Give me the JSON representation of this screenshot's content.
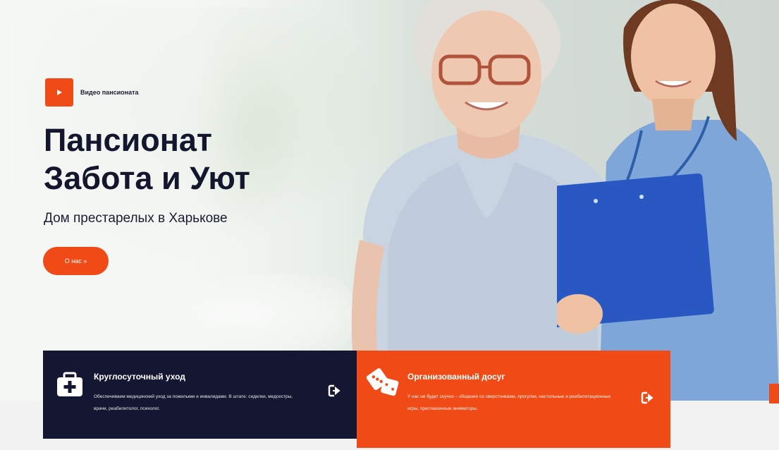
{
  "hero": {
    "video_label": "Видео пансионата",
    "title_line1": "Пансионат",
    "title_line2": "Забота и Уют",
    "subtitle": "Дом престарелых в Харькове",
    "about_button": "О нас »"
  },
  "features": [
    {
      "title": "Круглосуточный уход",
      "text": "Обеспечиваем медицинский уход за пожилыми и инвалидами. В штате: сиделки, медсестры, врачи, реабилитолог, психолог.",
      "icon": "first-aid-kit-icon"
    },
    {
      "title": "Организованный досуг",
      "text": "У нас не будет скучно – общение со сверстниками, прогулки, настольные и реабилитационные игры, приглашенные аниматоры.",
      "icon": "dice-icon"
    }
  ],
  "colors": {
    "accent": "#f04b17",
    "dark": "#151632"
  }
}
